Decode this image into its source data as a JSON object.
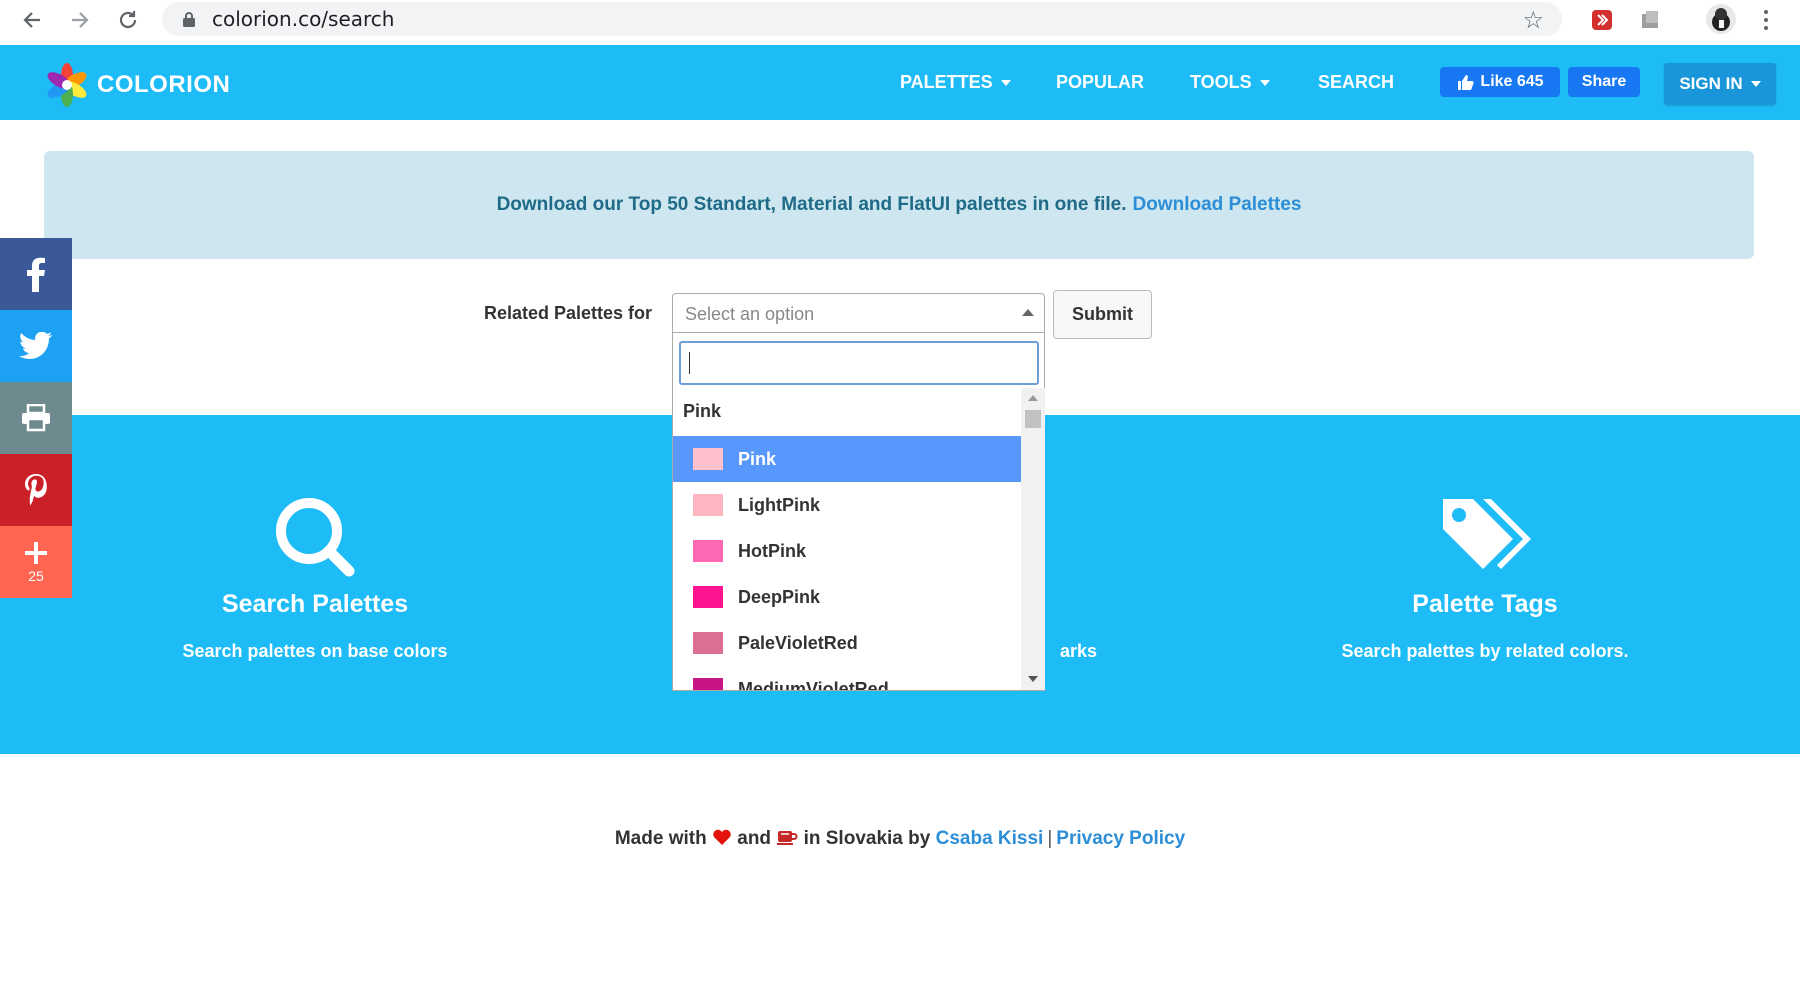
{
  "browser": {
    "url": "colorion.co/search"
  },
  "header": {
    "brand": "COLORION",
    "nav": [
      {
        "label": "PALETTES",
        "has_caret": true
      },
      {
        "label": "POPULAR",
        "has_caret": false
      },
      {
        "label": "TOOLS",
        "has_caret": true
      },
      {
        "label": "SEARCH",
        "has_caret": false
      }
    ],
    "fb_like_label": "Like 645",
    "fb_share_label": "Share",
    "signin_label": "SIGN IN"
  },
  "notice": {
    "text": "Download our Top 50 Standart, Material and FlatUI palettes in one file.",
    "link": "Download Palettes"
  },
  "search_form": {
    "label": "Related Palettes for",
    "select_placeholder": "Select an option",
    "submit_label": "Submit"
  },
  "dropdown": {
    "search_value": "",
    "group_label": "Pink",
    "options": [
      {
        "label": "Pink",
        "swatch": "#ffc0cb",
        "selected": true
      },
      {
        "label": "LightPink",
        "swatch": "#ffb6c1",
        "selected": false
      },
      {
        "label": "HotPink",
        "swatch": "#ff69b4",
        "selected": false
      },
      {
        "label": "DeepPink",
        "swatch": "#ff1493",
        "selected": false
      },
      {
        "label": "PaleVioletRed",
        "swatch": "#db7093",
        "selected": false
      },
      {
        "label": "MediumVioletRed",
        "swatch": "#c71585",
        "selected": false
      }
    ]
  },
  "features": [
    {
      "title": "Search Palettes",
      "description": "Search palettes on base colors",
      "icon": "magnifier-icon"
    },
    {
      "partial_text": "arks"
    },
    {
      "title": "Palette Tags",
      "description": "Search palettes by related colors.",
      "icon": "tags-icon"
    }
  ],
  "social": {
    "plus_count": "25"
  },
  "footer": {
    "made_with": "Made with",
    "and": "and",
    "in_slovakia_by": "in Slovakia by",
    "author": "Csaba Kissi",
    "separator": "|",
    "privacy": "Privacy Policy"
  },
  "colors": {
    "brand_blue": "#1ebcf7",
    "signin_blue": "#1896d9",
    "facebook_blue": "#1877f2",
    "notice_bg": "#cde6f0",
    "selected_option": "#5897fb"
  }
}
